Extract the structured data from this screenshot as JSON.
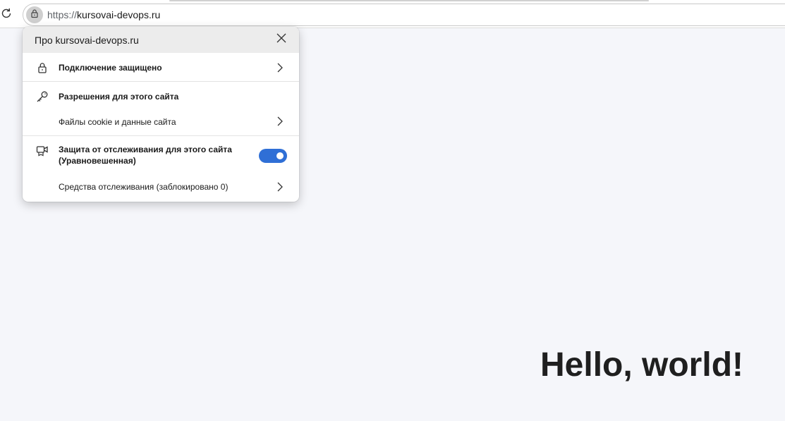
{
  "address_bar": {
    "scheme": "https://",
    "host": "kursovai-devops.ru"
  },
  "popup": {
    "title": "Про kursovai-devops.ru",
    "connection_label": "Подключение защищено",
    "permissions_label": "Разрешения для этого сайта",
    "cookies_label": "Файлы cookie и данные сайта",
    "tracking_label_line1": "Защита от отслеживания для этого сайта",
    "tracking_label_line2": "(Уравновешенная)",
    "tracking_enabled": true,
    "trackers_label": "Средства отслеживания (заблокировано 0)"
  },
  "page": {
    "heading": "Hello, world!"
  },
  "colors": {
    "accent": "#2f6fd6",
    "page_bg": "#f5f6fa",
    "popup_header_bg": "#ececec"
  },
  "icons": [
    "reload-icon",
    "lock-icon",
    "close-icon",
    "key-icon",
    "camera-shield-icon",
    "chevron-right-icon"
  ]
}
